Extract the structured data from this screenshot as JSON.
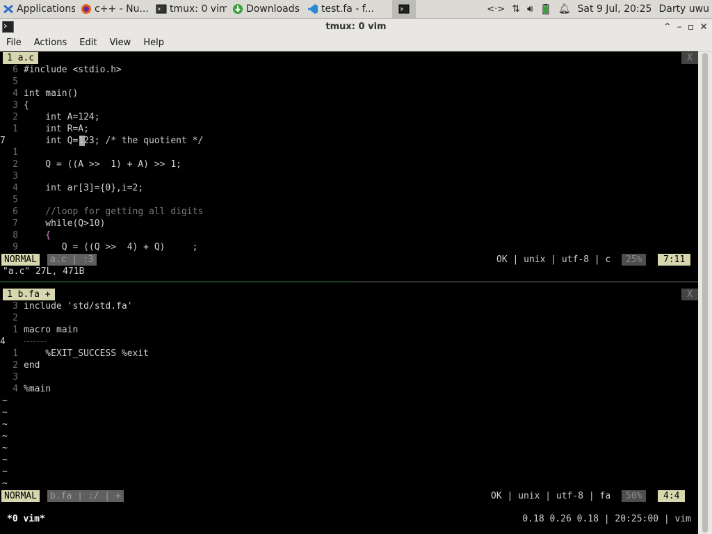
{
  "panel": {
    "tasks": [
      {
        "label": "Applications",
        "icon": "xfce-icon"
      },
      {
        "label": "c++ - Nu...",
        "icon": "firefox-icon"
      },
      {
        "label": "tmux: 0 vim",
        "icon": "terminal-icon"
      },
      {
        "label": "Downloads",
        "icon": "download-icon"
      },
      {
        "label": "test.fa - f...",
        "icon": "vscode-icon"
      }
    ],
    "clock": "Sat  9 Jul, 20:25",
    "user": "Darty uwu"
  },
  "window": {
    "title": "tmux: 0 vim",
    "menu": [
      "File",
      "Actions",
      "Edit",
      "View",
      "Help"
    ]
  },
  "top_pane": {
    "tab_label": "1 a.c",
    "close_label": "X",
    "lines": [
      {
        "n": "6",
        "text": "#include <stdio.h>"
      },
      {
        "n": "5",
        "text": ""
      },
      {
        "n": "4",
        "text": "int main()"
      },
      {
        "n": "3",
        "text": "{"
      },
      {
        "n": "2",
        "text": "    int A=124;"
      },
      {
        "n": "1",
        "text": "    int R=A;"
      },
      {
        "n": "7",
        "text": "    int Q=123; /* the quotient */",
        "current": true
      },
      {
        "n": "1",
        "text": ""
      },
      {
        "n": "2",
        "text": "    Q = ((A >>  1) + A) >> 1;"
      },
      {
        "n": "3",
        "text": ""
      },
      {
        "n": "4",
        "text": "    int ar[3]={0},i=2;"
      },
      {
        "n": "5",
        "text": ""
      },
      {
        "n": "6",
        "text": "    //loop for getting all digits"
      },
      {
        "n": "7",
        "text": "    while(Q>10)"
      },
      {
        "n": "8",
        "text": "    {"
      },
      {
        "n": "9",
        "text": "       Q = ((Q >>  4) + Q)     ;"
      }
    ],
    "status": {
      "mode": "NORMAL",
      "file": "a.c | :3",
      "info": "OK | unix | utf-8 | c",
      "percent": "25%",
      "position": "7:11"
    },
    "message": "\"a.c\" 27L, 471B"
  },
  "bottom_pane": {
    "tab_label": "1 b.fa +",
    "close_label": "X",
    "lines": [
      {
        "n": "3",
        "text": "include 'std/std.fa'"
      },
      {
        "n": "2",
        "text": ""
      },
      {
        "n": "1",
        "text": "macro main"
      },
      {
        "n": "4",
        "text": "",
        "current": true
      },
      {
        "n": "1",
        "text": "    %EXIT_SUCCESS %exit"
      },
      {
        "n": "2",
        "text": "end"
      },
      {
        "n": "3",
        "text": ""
      },
      {
        "n": "4",
        "text": "%main"
      }
    ],
    "tilde": "~",
    "status": {
      "mode": "NORMAL",
      "file": "b.fa | :/ | +",
      "info": "OK | unix | utf-8 | fa",
      "percent": "50%",
      "position": "4:4"
    }
  },
  "tmux": {
    "window": "*0 vim*",
    "right": "0.18 0.26 0.18 | 20:25:00 | vim"
  }
}
